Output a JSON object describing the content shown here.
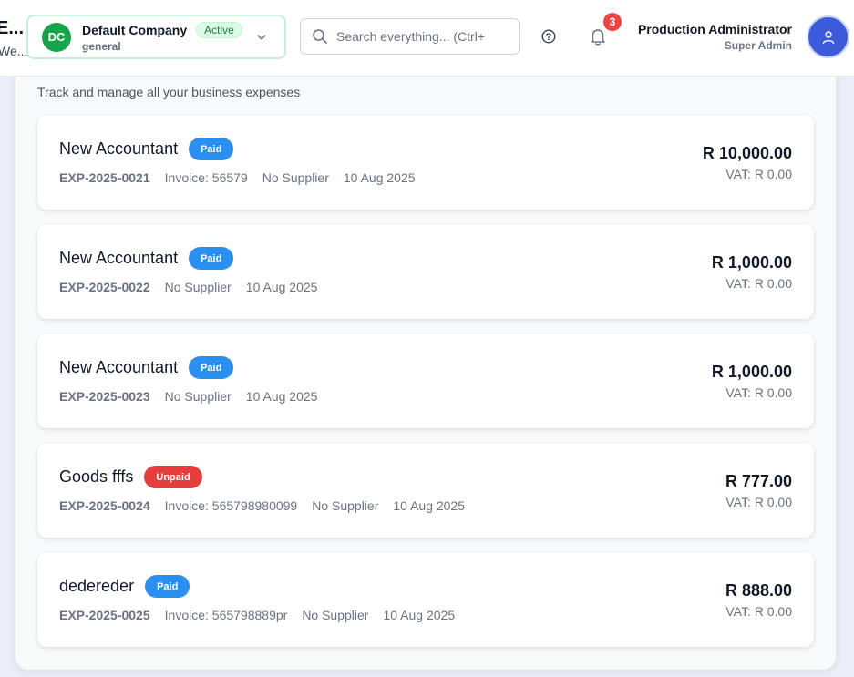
{
  "page_header": {
    "title_truncated": "E...",
    "subtitle_truncated": "We..."
  },
  "company": {
    "initials": "DC",
    "name": "Default Company",
    "status": "Active",
    "type": "general"
  },
  "search": {
    "placeholder": "Search everything... (Ctrl+"
  },
  "notifications": {
    "count": "3"
  },
  "user": {
    "name": "Production Administrator",
    "role": "Super Admin"
  },
  "main": {
    "subtitle": "Track and manage all your business expenses"
  },
  "expenses": [
    {
      "title": "New Accountant",
      "status": "Paid",
      "number": "EXP-2025-0021",
      "invoice": "Invoice: 56579",
      "supplier": "No Supplier",
      "date": "10 Aug 2025",
      "amount": "R 10,000.00",
      "vat": "VAT: R 0.00"
    },
    {
      "title": "New Accountant",
      "status": "Paid",
      "number": "EXP-2025-0022",
      "invoice": "",
      "supplier": "No Supplier",
      "date": "10 Aug 2025",
      "amount": "R 1,000.00",
      "vat": "VAT: R 0.00"
    },
    {
      "title": "New Accountant",
      "status": "Paid",
      "number": "EXP-2025-0023",
      "invoice": "",
      "supplier": "No Supplier",
      "date": "10 Aug 2025",
      "amount": "R 1,000.00",
      "vat": "VAT: R 0.00"
    },
    {
      "title": "Goods fffs",
      "status": "Unpaid",
      "number": "EXP-2025-0024",
      "invoice": "Invoice: 565798980099",
      "supplier": "No Supplier",
      "date": "10 Aug 2025",
      "amount": "R 777.00",
      "vat": "VAT: R 0.00"
    },
    {
      "title": "dedereder",
      "status": "Paid",
      "number": "EXP-2025-0025",
      "invoice": "Invoice: 565798889pr",
      "supplier": "No Supplier",
      "date": "10 Aug 2025",
      "amount": "R 888.00",
      "vat": "VAT: R 0.00"
    }
  ],
  "colors": {
    "paid": "#2b8ff0",
    "unpaid": "#e53e3e",
    "company_avatar": "#16a34a",
    "user_avatar": "#3b5bdb",
    "notification_badge": "#ef4444"
  },
  "icons": {
    "search": "search-icon",
    "chevron": "chevron-down-icon",
    "help": "help-circle-icon",
    "bell": "bell-icon",
    "user": "user-icon"
  }
}
